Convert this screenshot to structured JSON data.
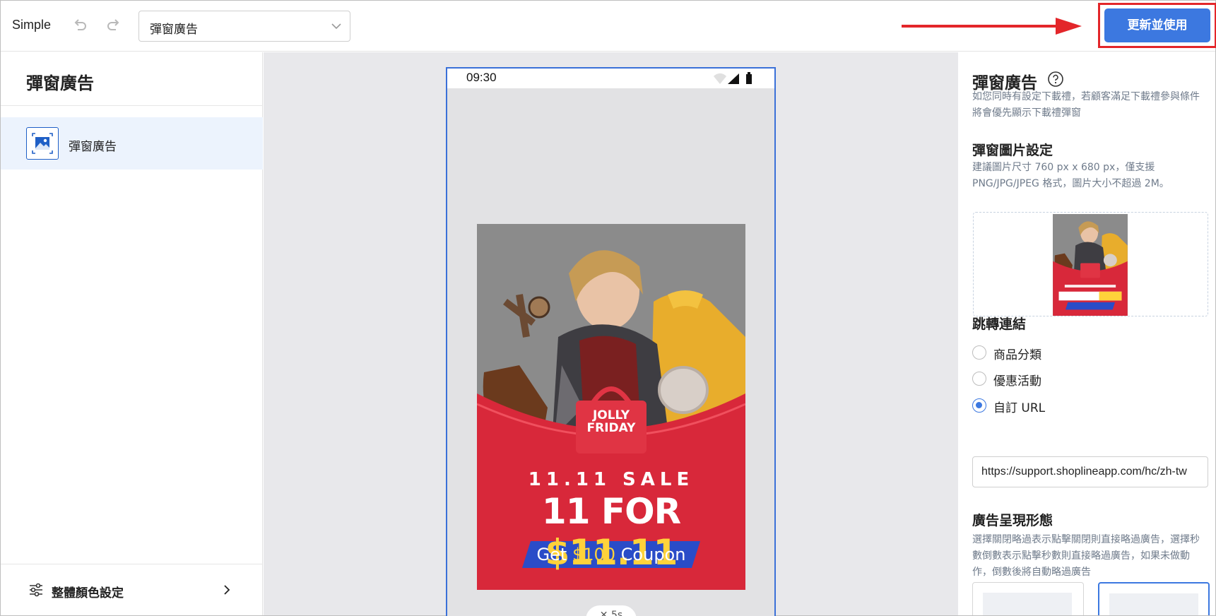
{
  "app": {
    "brand": "Simple"
  },
  "toolbar": {
    "undo_icon": "undo-icon",
    "redo_icon": "redo-icon",
    "page_select_value": "彈窗廣告",
    "primary_button_label": "更新並使用",
    "accent_color": "#3c78e0",
    "highlight_color": "#e3262a"
  },
  "sidebar": {
    "title": "彈窗廣告",
    "items": [
      {
        "label": "彈窗廣告",
        "icon": "image-icon",
        "selected": true
      }
    ],
    "footer": {
      "label": "整體顏色設定",
      "icon": "sliders-icon"
    }
  },
  "preview": {
    "status_time": "09:30",
    "ad": {
      "bag_line1": "JOLLY",
      "bag_line2": "FRIDAY",
      "sale_line": "11.11 SALE",
      "big_line_prefix": "11 FOR ",
      "big_line_price": "$11.11",
      "coupon_prefix": "Get ",
      "coupon_amount": "$100",
      "coupon_suffix": " Coupon"
    },
    "close_label": "✕ 5s"
  },
  "settings": {
    "title": "彈窗廣告",
    "description": "如您同時有設定下載禮，若顧客滿足下載禮參與條件將會優先顯示下載禮彈窗",
    "image_section": {
      "title": "彈窗圖片設定",
      "hint": "建議圖片尺寸 760 px x 680 px，僅支援 PNG/JPG/JPEG 格式，圖片大小不超過 2M。"
    },
    "link_section": {
      "title": "跳轉連結",
      "options": [
        {
          "label": "商品分類",
          "checked": false
        },
        {
          "label": "優惠活動",
          "checked": false
        },
        {
          "label": "自訂 URL",
          "checked": true
        }
      ],
      "url_value": "https://support.shoplineapp.com/hc/zh-tw"
    },
    "display_section": {
      "title": "廣告呈現形態",
      "description": "選擇關閉略過表示點擊關閉則直接略過廣告，選擇秒數倒數表示點擊秒數則直接略過廣告，如果未做動作，倒數後將自動略過廣告"
    }
  }
}
